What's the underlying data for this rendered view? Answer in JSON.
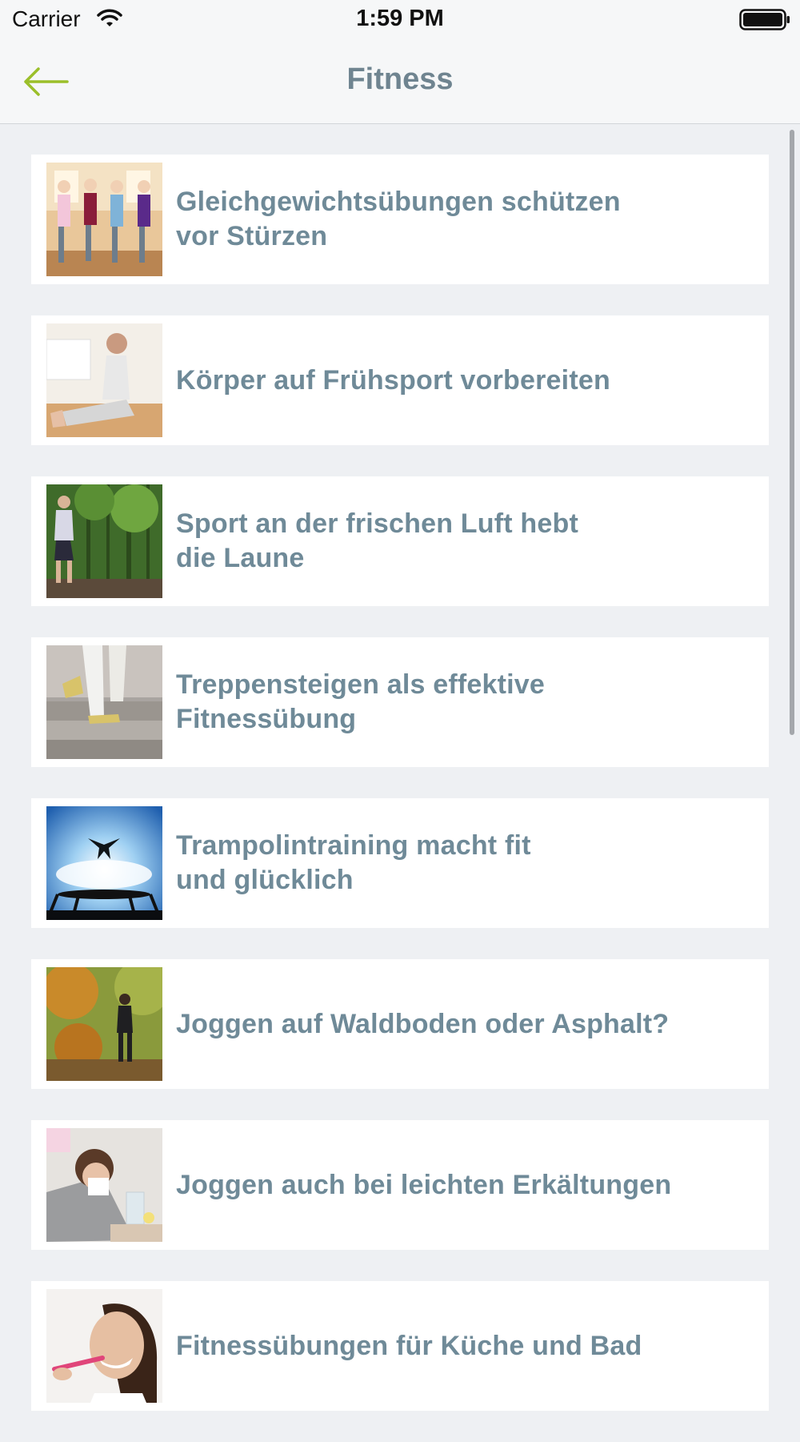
{
  "status_bar": {
    "carrier": "Carrier",
    "time": "1:59 PM"
  },
  "nav": {
    "title": "Fitness",
    "back_icon": "arrow-left-icon"
  },
  "colors": {
    "accent": "#9bbf2a",
    "title": "#6f8a98",
    "background": "#eef0f3"
  },
  "articles": [
    {
      "title": "Gleichgewichtsübungen schützen\nvor Stürzen",
      "thumb": "yoga-group"
    },
    {
      "title": "Körper auf Frühsport vorbereiten",
      "thumb": "stretching"
    },
    {
      "title": "Sport an der frischen Luft hebt\ndie Laune",
      "thumb": "forest-run"
    },
    {
      "title": "Treppensteigen als effektive\nFitnessübung",
      "thumb": "stairs"
    },
    {
      "title": "Trampolintraining macht fit\nund glücklich",
      "thumb": "trampoline"
    },
    {
      "title": "Joggen auf Waldboden oder Asphalt?",
      "thumb": "autumn-jog"
    },
    {
      "title": "Joggen auch bei leichten Erkältungen",
      "thumb": "cold"
    },
    {
      "title": "Fitnessübungen für Küche und Bad",
      "thumb": "toothbrush"
    }
  ]
}
